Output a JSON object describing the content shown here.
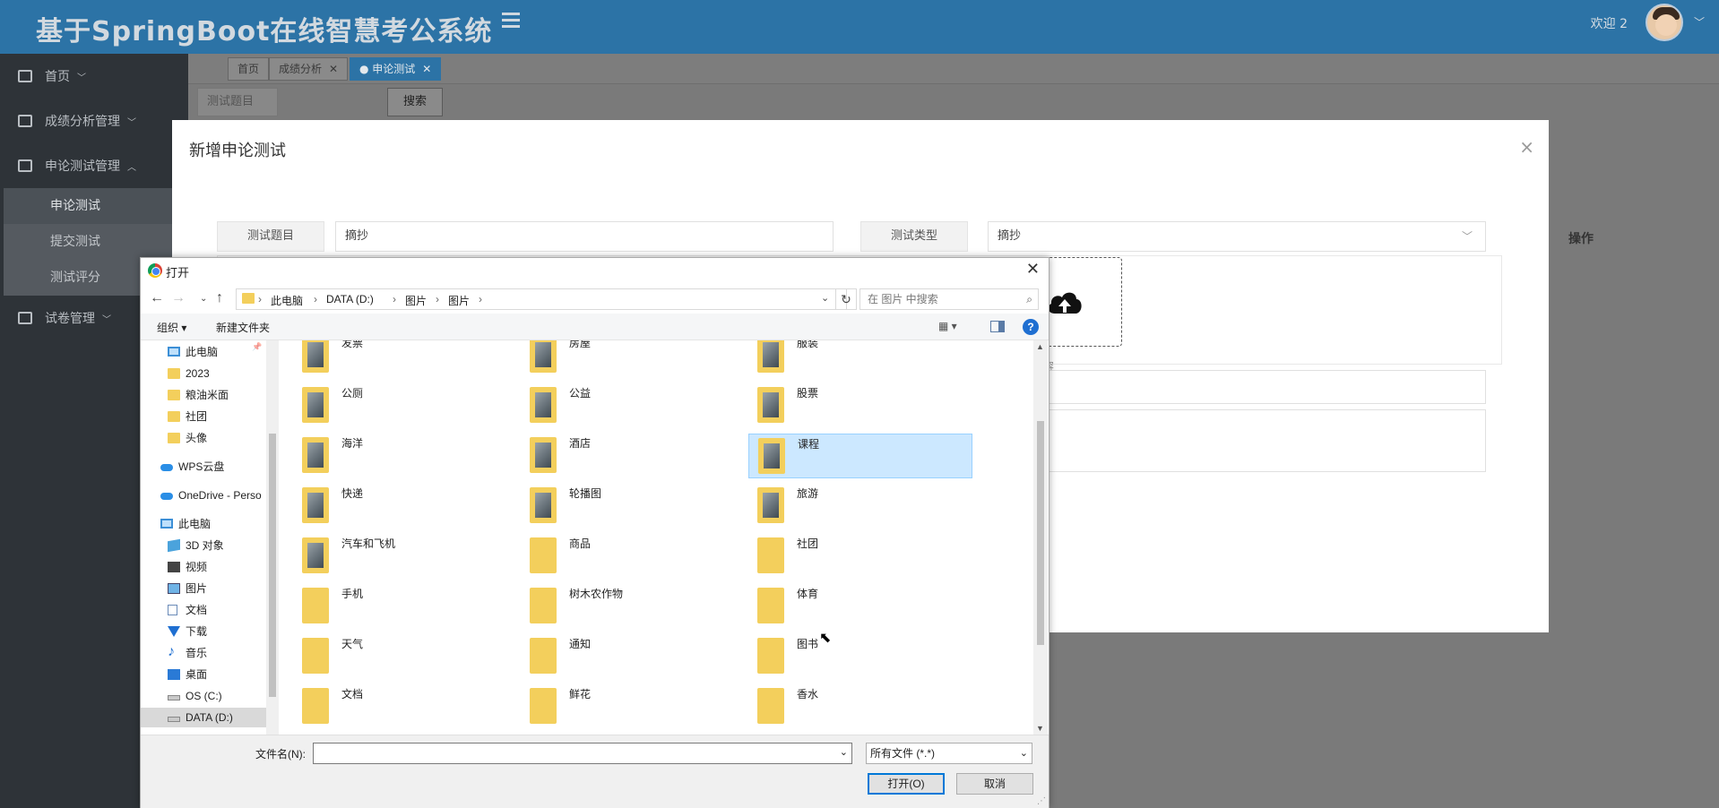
{
  "app": {
    "title": "基于SpringBoot在线智慧考公系统",
    "welcome": "欢迎 2",
    "accent_color": "#2c73a6"
  },
  "sidebar": {
    "items": [
      {
        "label": "首页",
        "icon": "home-icon",
        "caret": "﹀"
      },
      {
        "label": "成绩分析管理",
        "icon": "chart-icon",
        "caret": "﹀"
      },
      {
        "label": "申论测试管理",
        "icon": "copy-icon",
        "caret": "︿"
      },
      {
        "label": "试卷管理",
        "icon": "book-icon",
        "caret": "﹀"
      }
    ],
    "subitems": [
      "申论测试",
      "提交测试",
      "测试评分"
    ]
  },
  "tabs": [
    {
      "label": "首页"
    },
    {
      "label": "成绩分析",
      "close": "✕"
    },
    {
      "label": "● 申论测试",
      "close": "✕"
    }
  ],
  "search": {
    "field_label": "测试题目",
    "button": "搜索"
  },
  "table": {
    "ops_header": "操作"
  },
  "modal": {
    "title": "新增申论测试",
    "close": "×",
    "fields": {
      "title_label": "测试题目",
      "title_value": "摘抄",
      "type_label": "测试类型",
      "type_value": "摘抄",
      "upload_hint": "容"
    }
  },
  "dialog": {
    "title": "打开",
    "close": "✕",
    "breadcrumbs": [
      "此电脑",
      "DATA (D:)",
      "图片",
      "图片"
    ],
    "search_placeholder": "在 图片 中搜索",
    "organize": "组织 ▾",
    "new_folder": "新建文件夹",
    "help": "?",
    "nav": [
      {
        "label": "此电脑",
        "icon": "pc-icon"
      },
      {
        "label": "2023",
        "icon": "folder-icon"
      },
      {
        "label": "粮油米面",
        "icon": "folder-icon"
      },
      {
        "label": "社团",
        "icon": "folder-icon"
      },
      {
        "label": "头像",
        "icon": "folder-icon"
      },
      {
        "label": "WPS云盘",
        "icon": "cloud-icon"
      },
      {
        "label": "OneDrive - Perso",
        "icon": "cloud-icon"
      },
      {
        "label": "此电脑",
        "icon": "pc-icon"
      },
      {
        "label": "3D 对象",
        "icon": "cube-icon"
      },
      {
        "label": "视频",
        "icon": "video-icon"
      },
      {
        "label": "图片",
        "icon": "picture-icon"
      },
      {
        "label": "文档",
        "icon": "document-icon"
      },
      {
        "label": "下载",
        "icon": "download-icon"
      },
      {
        "label": "音乐",
        "icon": "music-icon"
      },
      {
        "label": "桌面",
        "icon": "desktop-icon"
      },
      {
        "label": "OS (C:)",
        "icon": "drive-icon"
      },
      {
        "label": "DATA (D:)",
        "icon": "drive-icon"
      }
    ],
    "files": [
      {
        "name": "发票",
        "photo": true
      },
      {
        "name": "房屋",
        "photo": true
      },
      {
        "name": "服装",
        "photo": true
      },
      {
        "name": "公厕",
        "photo": true
      },
      {
        "name": "公益",
        "photo": true
      },
      {
        "name": "股票",
        "photo": true
      },
      {
        "name": "海洋",
        "photo": true
      },
      {
        "name": "酒店",
        "photo": true
      },
      {
        "name": "课程",
        "photo": true
      },
      {
        "name": "快递",
        "photo": true
      },
      {
        "name": "轮播图",
        "photo": true
      },
      {
        "name": "旅游",
        "photo": true
      },
      {
        "name": "汽车和飞机",
        "photo": true
      },
      {
        "name": "商品",
        "photo": false
      },
      {
        "name": "社团",
        "photo": false
      },
      {
        "name": "手机",
        "photo": false
      },
      {
        "name": "树木农作物",
        "photo": false
      },
      {
        "name": "体育",
        "photo": false
      },
      {
        "name": "天气",
        "photo": false
      },
      {
        "name": "通知",
        "photo": false
      },
      {
        "name": "图书",
        "photo": false
      },
      {
        "name": "文档",
        "photo": false
      },
      {
        "name": "鲜花",
        "photo": false
      },
      {
        "name": "香水",
        "photo": false
      }
    ],
    "selected_file": "课程",
    "filename_label": "文件名(N):",
    "filename_value": "",
    "filetype": "所有文件 (*.*)",
    "open_button": "打开(O)",
    "cancel_button": "取消"
  }
}
